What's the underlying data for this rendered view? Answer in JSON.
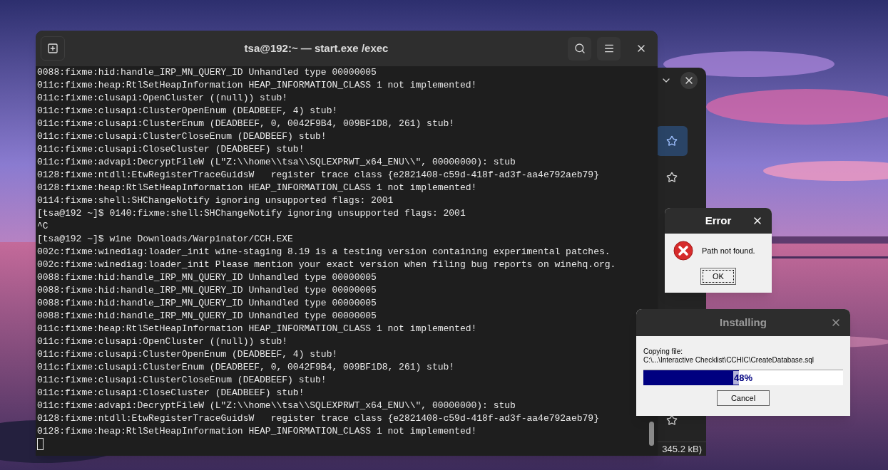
{
  "terminal": {
    "title": "tsa@192:~ — start.exe /exec",
    "lines": [
      "0088:fixme:hid:handle_IRP_MN_QUERY_ID Unhandled type 00000005",
      "011c:fixme:heap:RtlSetHeapInformation HEAP_INFORMATION_CLASS 1 not implemented!",
      "011c:fixme:clusapi:OpenCluster ((null)) stub!",
      "011c:fixme:clusapi:ClusterOpenEnum (DEADBEEF, 4) stub!",
      "011c:fixme:clusapi:ClusterEnum (DEADBEEF, 0, 0042F9B4, 009BF1D8, 261) stub!",
      "011c:fixme:clusapi:ClusterCloseEnum (DEADBEEF) stub!",
      "011c:fixme:clusapi:CloseCluster (DEADBEEF) stub!",
      "011c:fixme:advapi:DecryptFileW (L\"Z:\\\\home\\\\tsa\\\\SQLEXPRWT_x64_ENU\\\\\", 00000000): stub",
      "0128:fixme:ntdll:EtwRegisterTraceGuidsW   register trace class {e2821408-c59d-418f-ad3f-aa4e792aeb79}",
      "0128:fixme:heap:RtlSetHeapInformation HEAP_INFORMATION_CLASS 1 not implemented!",
      "0114:fixme:shell:SHChangeNotify ignoring unsupported flags: 2001",
      "[tsa@192 ~]$ 0140:fixme:shell:SHChangeNotify ignoring unsupported flags: 2001",
      "^C",
      "[tsa@192 ~]$ wine Downloads/Warpinator/CCH.EXE",
      "002c:fixme:winediag:loader_init wine-staging 8.19 is a testing version containing experimental patches.",
      "002c:fixme:winediag:loader_init Please mention your exact version when filing bug reports on winehq.org.",
      "0088:fixme:hid:handle_IRP_MN_QUERY_ID Unhandled type 00000005",
      "0088:fixme:hid:handle_IRP_MN_QUERY_ID Unhandled type 00000005",
      "0088:fixme:hid:handle_IRP_MN_QUERY_ID Unhandled type 00000005",
      "0088:fixme:hid:handle_IRP_MN_QUERY_ID Unhandled type 00000005",
      "011c:fixme:heap:RtlSetHeapInformation HEAP_INFORMATION_CLASS 1 not implemented!",
      "011c:fixme:clusapi:OpenCluster ((null)) stub!",
      "011c:fixme:clusapi:ClusterOpenEnum (DEADBEEF, 4) stub!",
      "011c:fixme:clusapi:ClusterEnum (DEADBEEF, 0, 0042F9B4, 009BF1D8, 261) stub!",
      "011c:fixme:clusapi:ClusterCloseEnum (DEADBEEF) stub!",
      "011c:fixme:clusapi:CloseCluster (DEADBEEF) stub!",
      "011c:fixme:advapi:DecryptFileW (L\"Z:\\\\home\\\\tsa\\\\SQLEXPRWT_x64_ENU\\\\\", 00000000): stub",
      "0128:fixme:ntdll:EtwRegisterTraceGuidsW   register trace class {e2821408-c59d-418f-ad3f-aa4e792aeb79}",
      "0128:fixme:heap:RtlSetHeapInformation HEAP_INFORMATION_CLASS 1 not implemented!"
    ]
  },
  "file_manager": {
    "star_buttons": [
      {
        "selected": true
      },
      {
        "selected": false
      },
      {
        "selected": false
      }
    ],
    "status": "345.2 kB)"
  },
  "error_dialog": {
    "title": "Error",
    "message": "Path not found.",
    "button": "OK"
  },
  "install_dialog": {
    "title": "Installing",
    "active": false,
    "caption": "Copying file:",
    "path": "C:\\...\\Interactive Checklist\\CCHIC\\CreateDatabase.sql",
    "level": 0.48,
    "percent": "48%",
    "button": "Cancel"
  }
}
